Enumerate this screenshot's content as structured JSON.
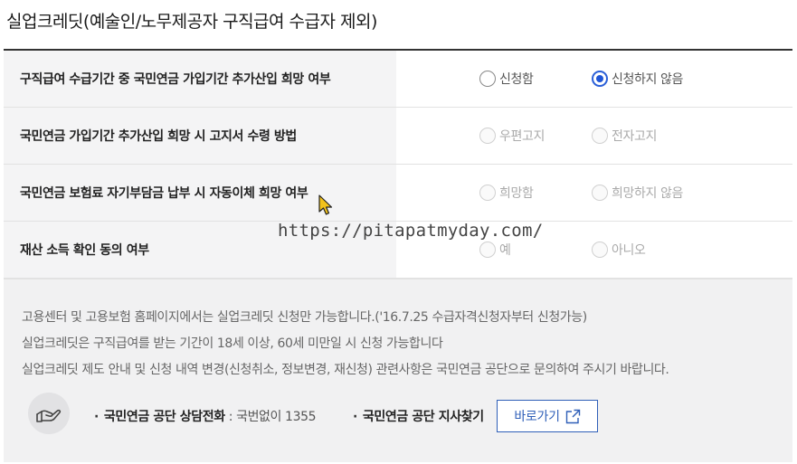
{
  "page": {
    "title": "실업크레딧(예술인/노무제공자 구직급여 수급자 제외)"
  },
  "rows": [
    {
      "label": "구직급여 수급기간 중 국민연금 가입기간 추가산입 희망 여부",
      "option_a": "신청함",
      "option_b": "신청하지 않음",
      "selected": "option_b",
      "enabled": true
    },
    {
      "label": "국민연금 가입기간 추가산입 희망 시 고지서 수령 방법",
      "option_a": "우편고지",
      "option_b": "전자고지",
      "selected": "",
      "enabled": false
    },
    {
      "label": "국민연금 보험료 자기부담금 납부 시 자동이체 희망 여부",
      "option_a": "희망함",
      "option_b": "희망하지 않음",
      "selected": "",
      "enabled": false
    },
    {
      "label": "재산 소득 확인 동의 여부",
      "option_a": "예",
      "option_b": "아니오",
      "selected": "",
      "enabled": false
    }
  ],
  "watermark": "https://pitapatmyday.com/",
  "notes": [
    "고용센터 및 고용보험 홈페이지에서는 실업크레딧 신청만 가능합니다.('16.7.25 수급자격신청자부터 신청가능)",
    "실업크레딧은 구직급여를 받는 기간이 18세 이상, 60세 미만일 시 신청 가능합니다",
    "실업크레딧 제도 안내 및 신청 내역 변경(신청취소, 정보변경, 재신청) 관련사항은 국민연금 공단으로 문의하여 주시기 바랍니다."
  ],
  "contact": {
    "icon": "helping-hand-icon",
    "phone_label": "국민연금 공단 상담전화",
    "phone_value": " : 국번없이 1355",
    "branch_label": "국민연금 공단 지사찾기",
    "go_button_label": "바로가기",
    "go_button_icon": "external-link-icon"
  },
  "colors": {
    "radio_selected": "#1f55d6",
    "button_border": "#2f5fb8",
    "label_background": "#f4f4f5",
    "info_background": "#f1f1f2"
  }
}
